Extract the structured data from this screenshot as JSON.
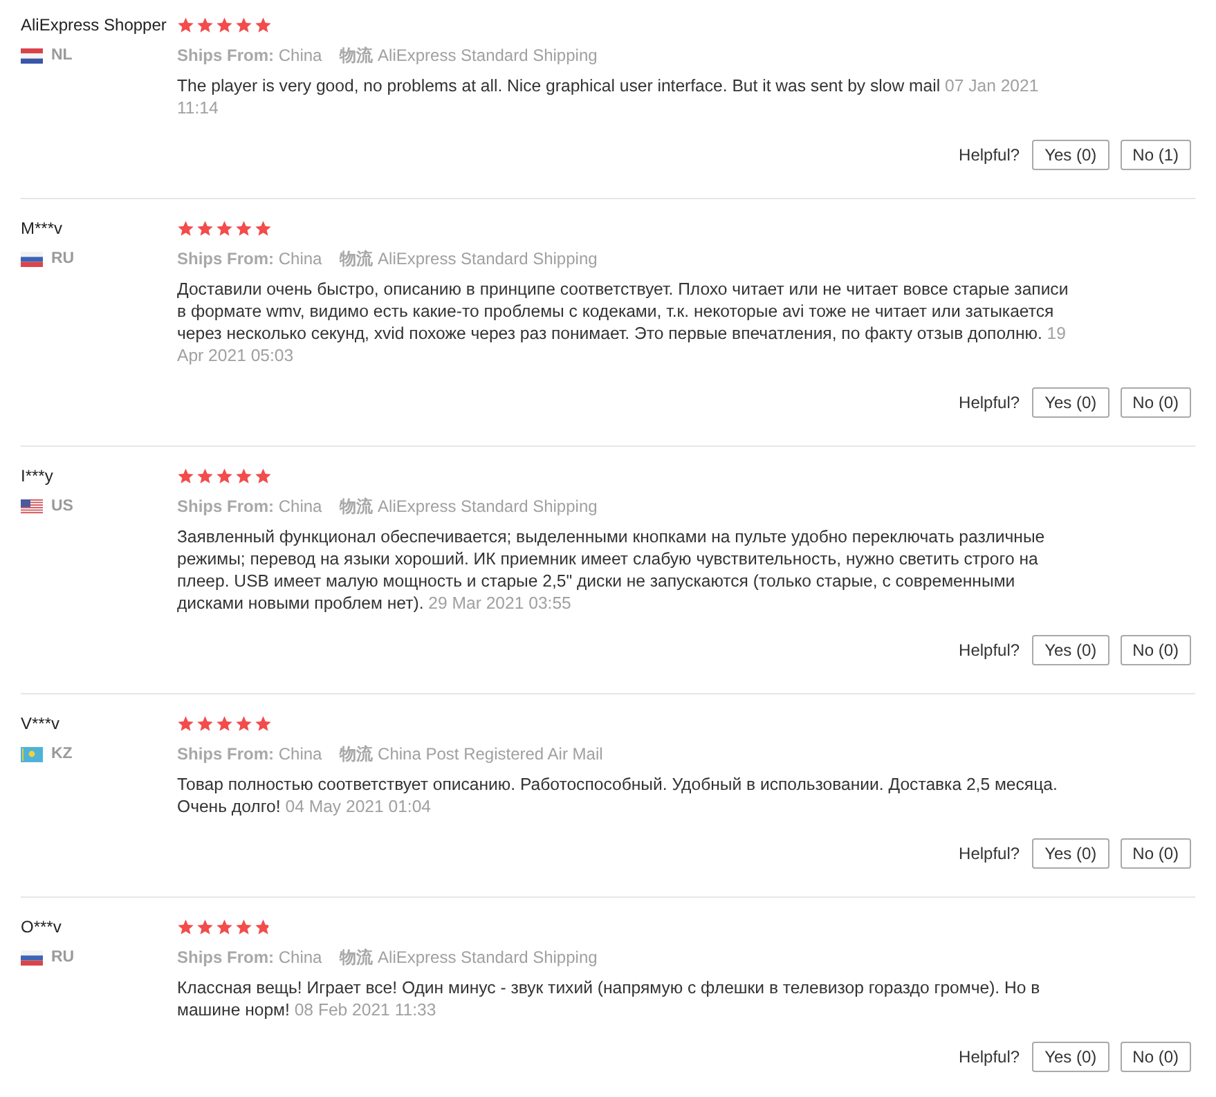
{
  "reviews": [
    {
      "author": "AliExpress Shopper",
      "stars": 5,
      "flag": {
        "kind": "nl"
      },
      "country": "NL",
      "ships_from": "**Ships From:** China",
      "logistics": "**物流** AliExpress Standard Shipping",
      "text": "The player is very good, no problems at all. Nice graphical user interface. But it was sent by slow mail",
      "date": "07 Jan 2021 11:14",
      "helpful_label": "Helpful?",
      "yes": "Yes (0)",
      "no": "No (1)"
    },
    {
      "author": "M***v",
      "stars": 5,
      "flag": {
        "kind": "ru"
      },
      "country": "RU",
      "ships_from": "**Ships From:** China",
      "logistics": "**物流** AliExpress Standard Shipping",
      "text": "Доставили очень быстро, описанию в принципе соответствует. Плохо читает или не читает вовсе старые записи в формате wmv, видимо есть какие-то проблемы с кодеками, т.к. некоторые avi тоже не читает или затыкается через несколько секунд, xvid похоже через раз понимает. Это первые впечатления, по факту отзыв дополню.",
      "date": "19 Apr 2021 05:03",
      "helpful_label": "Helpful?",
      "yes": "Yes (0)",
      "no": "No (0)"
    },
    {
      "author": "I***y",
      "stars": 5,
      "flag": {
        "kind": "us"
      },
      "country": "US",
      "ships_from": "**Ships From:** China",
      "logistics": "**物流** AliExpress Standard Shipping",
      "text": "Заявленный функционал обеспечивается; выделенными кнопками на пульте удобно переключать различные режимы; перевод на языки хороший. ИК приемник имеет слабую чувствительность, нужно светить строго на плеер. USB имеет малую мощность и старые 2,5\" диски не запускаются (только старые, с современными дисками новыми проблем нет).",
      "date": "29 Mar 2021 03:55",
      "helpful_label": "Helpful?",
      "yes": "Yes (0)",
      "no": "No (0)"
    },
    {
      "author": "V***v",
      "stars": 5,
      "flag": {
        "kind": "kz"
      },
      "country": "KZ",
      "ships_from": "**Ships From:** China",
      "logistics": "**物流** China Post Registered Air Mail",
      "text": "Товар полностью соответствует описанию. Работоспособный. Удобный в использовании. Доставка 2,5 месяца. Очень долго!",
      "date": "04 May 2021 01:04",
      "helpful_label": "Helpful?",
      "yes": "Yes (0)",
      "no": "No (0)"
    },
    {
      "author": "O***v",
      "stars": 4.8,
      "flag": {
        "kind": "ru"
      },
      "country": "RU",
      "ships_from": "**Ships From:** China",
      "logistics": "**物流** AliExpress Standard Shipping",
      "text": "Классная вещь! Играет все! Один минус - звук тихий (напрямую с флешки в телевизор гораздо громче). Но в машине норм!",
      "date": "08 Feb 2021 11:33",
      "helpful_label": "Helpful?",
      "yes": "Yes (0)",
      "no": "No (0)"
    }
  ]
}
